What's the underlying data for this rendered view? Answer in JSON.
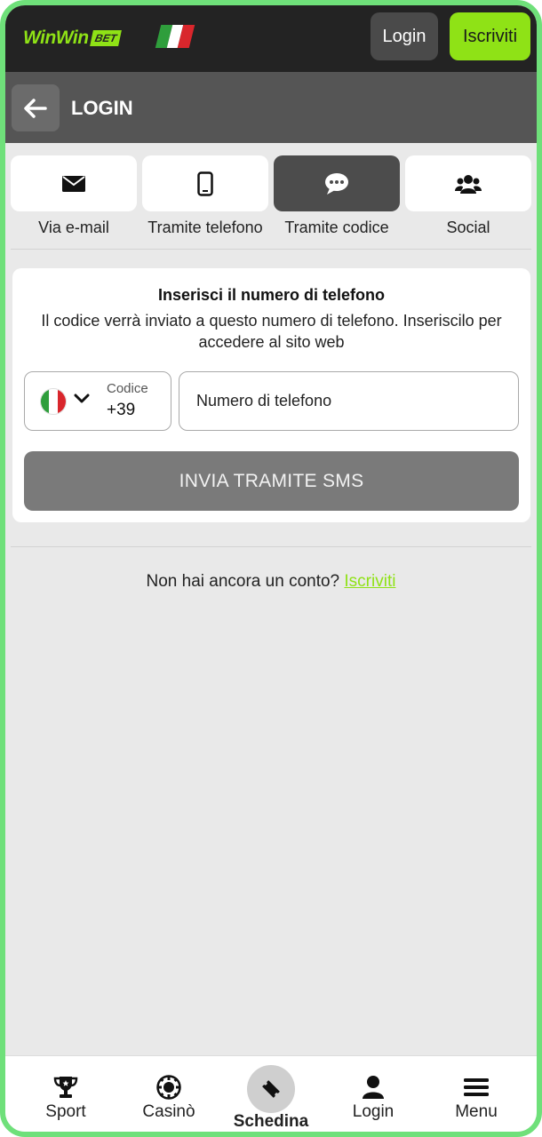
{
  "brand": {
    "logo_text": "WinWin",
    "logo_badge": "BET",
    "accent_color": "#8fe216"
  },
  "topbar": {
    "login_label": "Login",
    "signup_label": "Iscriviti"
  },
  "header": {
    "title": "LOGIN"
  },
  "tabs": [
    {
      "label": "Via e-mail",
      "icon": "envelope-icon",
      "active": false
    },
    {
      "label": "Tramite telefono",
      "icon": "phone-icon",
      "active": false
    },
    {
      "label": "Tramite codice",
      "icon": "chat-icon",
      "active": true
    },
    {
      "label": "Social",
      "icon": "users-icon",
      "active": false
    }
  ],
  "form": {
    "title": "Inserisci il numero di telefono",
    "description": "Il codice verrà inviato a questo numero di telefono. Inseriscilo per accedere al sito web",
    "country_code_label": "Codice",
    "country_code_value": "+39",
    "phone_placeholder": "Numero di telefono",
    "submit_label": "INVIA TRAMITE SMS"
  },
  "register": {
    "prompt": "Non hai ancora un conto?",
    "link_label": "Iscriviti"
  },
  "bottom_nav": [
    {
      "label": "Sport",
      "icon": "trophy-icon"
    },
    {
      "label": "Casinò",
      "icon": "casino-chip-icon"
    },
    {
      "label": "Schedina",
      "icon": "ticket-icon"
    },
    {
      "label": "Login",
      "icon": "user-icon"
    },
    {
      "label": "Menu",
      "icon": "menu-icon"
    }
  ]
}
